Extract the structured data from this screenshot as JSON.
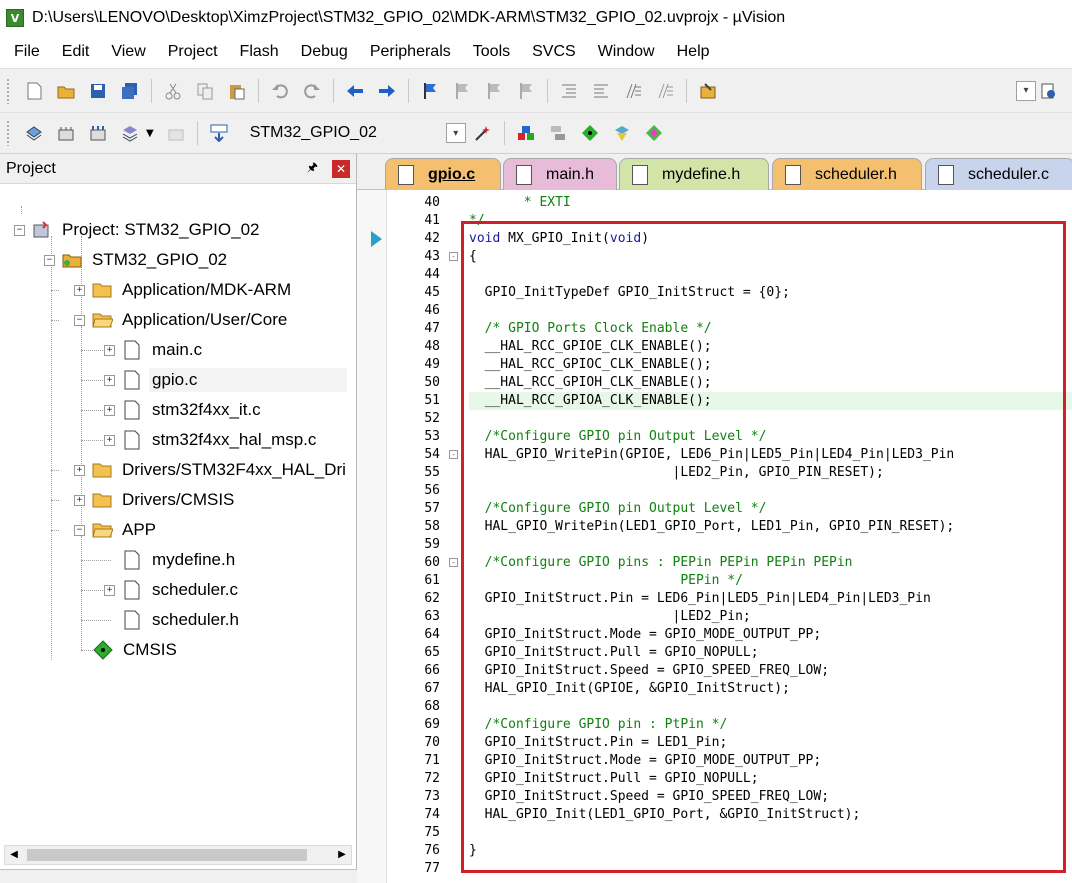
{
  "window": {
    "title": "D:\\Users\\LENOVO\\Desktop\\XimzProject\\STM32_GPIO_02\\MDK-ARM\\STM32_GPIO_02.uvprojx - µVision",
    "app_icon_letter": "V"
  },
  "menu": [
    "File",
    "Edit",
    "View",
    "Project",
    "Flash",
    "Debug",
    "Peripherals",
    "Tools",
    "SVCS",
    "Window",
    "Help"
  ],
  "toolbar2": {
    "target": "STM32_GPIO_02"
  },
  "project_panel": {
    "title": "Project",
    "tree": [
      {
        "label": "Project: STM32_GPIO_02"
      },
      {
        "label": "STM32_GPIO_02"
      },
      {
        "label": "Application/MDK-ARM"
      },
      {
        "label": "Application/User/Core"
      },
      {
        "label": "main.c"
      },
      {
        "label": "gpio.c"
      },
      {
        "label": "stm32f4xx_it.c"
      },
      {
        "label": "stm32f4xx_hal_msp.c"
      },
      {
        "label": "Drivers/STM32F4xx_HAL_Dri"
      },
      {
        "label": "Drivers/CMSIS"
      },
      {
        "label": "APP"
      },
      {
        "label": "mydefine.h"
      },
      {
        "label": "scheduler.c"
      },
      {
        "label": "scheduler.h"
      },
      {
        "label": "CMSIS"
      }
    ]
  },
  "editor": {
    "tabs": [
      {
        "label": "gpio.c",
        "color": "#f4c070"
      },
      {
        "label": "main.h",
        "color": "#e8bcd8"
      },
      {
        "label": "mydefine.h",
        "color": "#d2e4a8"
      },
      {
        "label": "scheduler.h",
        "color": "#f4c070"
      },
      {
        "label": "scheduler.c",
        "color": "#c8d4ec"
      }
    ],
    "lines": [
      {
        "n": "40",
        "t": "       * EXTI"
      },
      {
        "n": "41",
        "t": "*/"
      },
      {
        "n": "42",
        "t": "void MX_GPIO_Init(void)"
      },
      {
        "n": "43",
        "t": "{"
      },
      {
        "n": "44",
        "t": ""
      },
      {
        "n": "45",
        "t": "  GPIO_InitTypeDef GPIO_InitStruct = {0};"
      },
      {
        "n": "46",
        "t": ""
      },
      {
        "n": "47",
        "t": "  /* GPIO Ports Clock Enable */"
      },
      {
        "n": "48",
        "t": "  __HAL_RCC_GPIOE_CLK_ENABLE();"
      },
      {
        "n": "49",
        "t": "  __HAL_RCC_GPIOC_CLK_ENABLE();"
      },
      {
        "n": "50",
        "t": "  __HAL_RCC_GPIOH_CLK_ENABLE();"
      },
      {
        "n": "51",
        "t": "  __HAL_RCC_GPIOA_CLK_ENABLE();"
      },
      {
        "n": "52",
        "t": ""
      },
      {
        "n": "53",
        "t": "  /*Configure GPIO pin Output Level */"
      },
      {
        "n": "54",
        "t": "  HAL_GPIO_WritePin(GPIOE, LED6_Pin|LED5_Pin|LED4_Pin|LED3_Pin"
      },
      {
        "n": "55",
        "t": "                          |LED2_Pin, GPIO_PIN_RESET);"
      },
      {
        "n": "56",
        "t": ""
      },
      {
        "n": "57",
        "t": "  /*Configure GPIO pin Output Level */"
      },
      {
        "n": "58",
        "t": "  HAL_GPIO_WritePin(LED1_GPIO_Port, LED1_Pin, GPIO_PIN_RESET);"
      },
      {
        "n": "59",
        "t": ""
      },
      {
        "n": "60",
        "t": "  /*Configure GPIO pins : PEPin PEPin PEPin PEPin"
      },
      {
        "n": "61",
        "t": "                           PEPin */"
      },
      {
        "n": "62",
        "t": "  GPIO_InitStruct.Pin = LED6_Pin|LED5_Pin|LED4_Pin|LED3_Pin"
      },
      {
        "n": "63",
        "t": "                          |LED2_Pin;"
      },
      {
        "n": "64",
        "t": "  GPIO_InitStruct.Mode = GPIO_MODE_OUTPUT_PP;"
      },
      {
        "n": "65",
        "t": "  GPIO_InitStruct.Pull = GPIO_NOPULL;"
      },
      {
        "n": "66",
        "t": "  GPIO_InitStruct.Speed = GPIO_SPEED_FREQ_LOW;"
      },
      {
        "n": "67",
        "t": "  HAL_GPIO_Init(GPIOE, &GPIO_InitStruct);"
      },
      {
        "n": "68",
        "t": ""
      },
      {
        "n": "69",
        "t": "  /*Configure GPIO pin : PtPin */"
      },
      {
        "n": "70",
        "t": "  GPIO_InitStruct.Pin = LED1_Pin;"
      },
      {
        "n": "71",
        "t": "  GPIO_InitStruct.Mode = GPIO_MODE_OUTPUT_PP;"
      },
      {
        "n": "72",
        "t": "  GPIO_InitStruct.Pull = GPIO_NOPULL;"
      },
      {
        "n": "73",
        "t": "  GPIO_InitStruct.Speed = GPIO_SPEED_FREQ_LOW;"
      },
      {
        "n": "74",
        "t": "  HAL_GPIO_Init(LED1_GPIO_Port, &GPIO_InitStruct);"
      },
      {
        "n": "75",
        "t": ""
      },
      {
        "n": "76",
        "t": "}"
      },
      {
        "n": "77",
        "t": ""
      }
    ]
  },
  "colors": {
    "highlight_box": "#d2202a",
    "keyword": "#1a1aa0",
    "comment": "#108010",
    "current_line": "#e8f8e8"
  }
}
